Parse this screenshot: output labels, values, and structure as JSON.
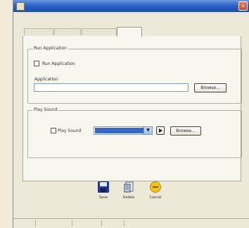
{
  "window": {
    "title": ""
  },
  "menu": {
    "items": [
      "",
      ""
    ]
  },
  "tabs": [
    {
      "label": ""
    },
    {
      "label": ""
    },
    {
      "label": ""
    },
    {
      "label": ""
    }
  ],
  "run_application": {
    "group_label": "Run Application",
    "checkbox_label": "Run Application",
    "checked": false,
    "application_label": "Application",
    "application_value": "",
    "browse_label": "Browse..."
  },
  "play_sound": {
    "group_label": "Play Sound",
    "checkbox_label": "Play Sound",
    "checked": false,
    "selected_sound": "",
    "browse_label": "Browse..."
  },
  "actions": [
    {
      "label": "Save",
      "icon": "save-icon"
    },
    {
      "label": "Delete",
      "icon": "delete-icon"
    },
    {
      "label": "Cancel",
      "icon": "cancel-icon"
    }
  ],
  "status": {
    "cells": [
      "",
      "",
      "",
      ""
    ]
  },
  "colors": {
    "title_bar": "#2f62c8",
    "selection": "#3566c8",
    "save_icon": "#1f3a8a",
    "cancel_icon": "#f1c21b"
  }
}
